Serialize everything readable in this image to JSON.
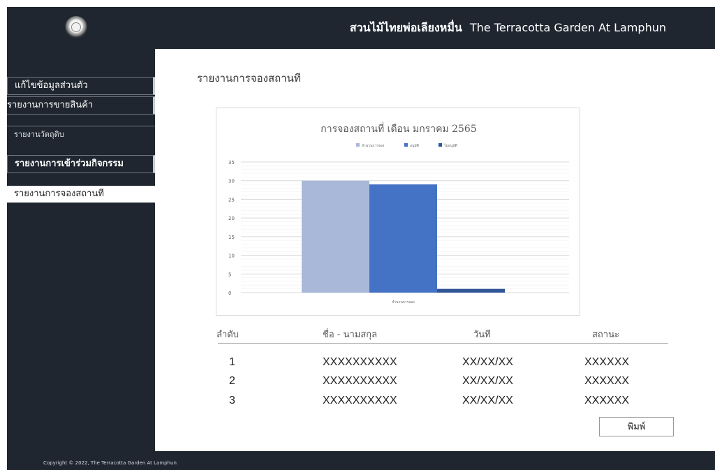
{
  "header": {
    "title_th": "สวนไม้ไทยพ่อเลียงหมื่น",
    "title_en": "The Terracotta Garden At Lamphun"
  },
  "sidebar": {
    "items": [
      {
        "label": "แก้ไขข้อมูลส่วนตัว"
      },
      {
        "label": "รายงานการขายสินค้า"
      },
      {
        "label": "รายงานวัตถุดิบ"
      },
      {
        "label": "รายงานการเข้าร่วมกิจกรรม"
      },
      {
        "label": "รายงานการจองสถานที"
      }
    ]
  },
  "page": {
    "title": "รายงานการจองสถานที",
    "print_label": "พิมพ์"
  },
  "chart_data": {
    "type": "bar",
    "title": "การจองสถานที่ เดือน มกราคม 2565",
    "categories": [
      "จำนวนการจอง"
    ],
    "series": [
      {
        "name": "จำนวนการจอง",
        "values": [
          30
        ],
        "color": "#a9b7d9"
      },
      {
        "name": "อนุมัติ",
        "values": [
          29
        ],
        "color": "#4472c4"
      },
      {
        "name": "ไม่อนุมัติ",
        "values": [
          1
        ],
        "color": "#2f5597"
      }
    ],
    "ylim": [
      0,
      35
    ],
    "yticks": [
      0,
      5,
      10,
      15,
      20,
      25,
      30,
      35
    ],
    "xlabel": "",
    "ylabel": "",
    "grid": true,
    "legend": "top"
  },
  "table": {
    "headers": [
      "ลำดับ",
      "ชื่อ - นามสกุล",
      "วันที",
      "สถานะ"
    ],
    "rows": [
      [
        "1",
        "XXXXXXXXXX",
        "XX/XX/XX",
        "XXXXXX"
      ],
      [
        "2",
        "XXXXXXXXXX",
        "XX/XX/XX",
        "XXXXXX"
      ],
      [
        "3",
        "XXXXXXXXXX",
        "XX/XX/XX",
        "XXXXXX"
      ]
    ]
  },
  "footer": {
    "copyright": "Copyright © 2022, The Terracotta Garden At Lamphun"
  }
}
